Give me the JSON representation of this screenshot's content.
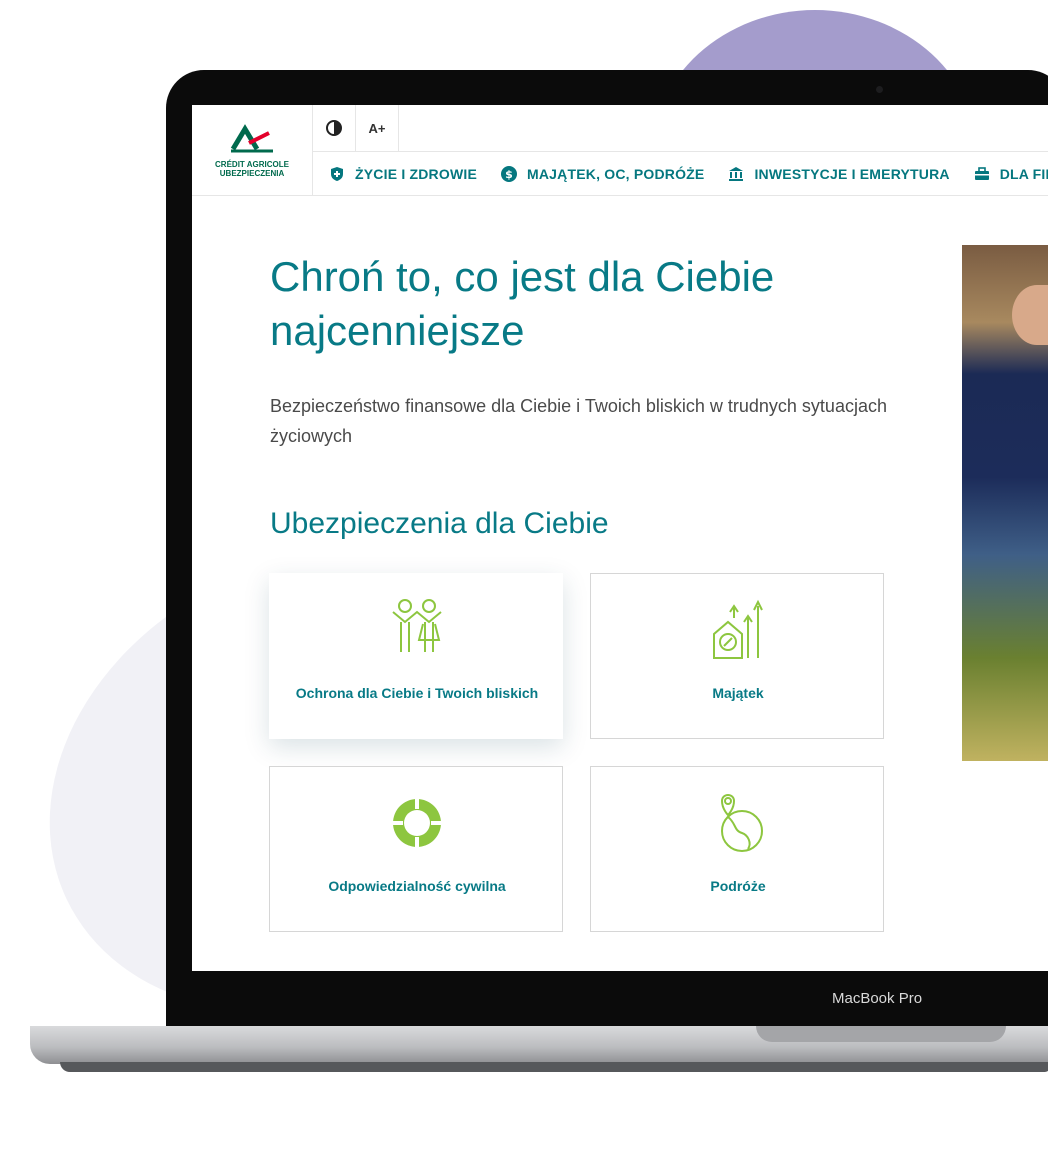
{
  "device": {
    "label": "MacBook Pro"
  },
  "logo": {
    "line1": "CRÉDIT AGRICOLE",
    "line2": "UBEZPIECZENIA"
  },
  "utility": {
    "contrast_icon": "contrast-icon",
    "font_size_label": "A+"
  },
  "nav": [
    {
      "label": "ŻYCIE I ZDROWIE",
      "icon": "shield-plus-icon"
    },
    {
      "label": "MAJĄTEK, OC, PODRÓŻE",
      "icon": "dollar-icon"
    },
    {
      "label": "INWESTYCJE I EMERYTURA",
      "icon": "bank-icon"
    },
    {
      "label": "DLA FIR",
      "icon": "briefcase-icon"
    }
  ],
  "hero": {
    "title": "Chroń to, co jest dla Ciebie najcenniejsze",
    "subtitle": "Bezpieczeństwo finansowe dla Ciebie i Twoich bliskich w trudnych sytuacjach życiowych"
  },
  "section": {
    "title": "Ubezpieczenia dla Ciebie"
  },
  "cards": [
    {
      "label": "Ochrona dla Ciebie i Twoich bliskich",
      "icon": "family-icon"
    },
    {
      "label": "Majątek",
      "icon": "property-growth-icon"
    },
    {
      "label": "Odpowiedzialność cywilna",
      "icon": "lifebuoy-icon"
    },
    {
      "label": "Podróże",
      "icon": "globe-pin-icon"
    }
  ],
  "colors": {
    "brand_teal": "#087a86",
    "icon_green": "#8dc63f",
    "logo_green": "#006a4d",
    "logo_red": "#e4002b"
  }
}
